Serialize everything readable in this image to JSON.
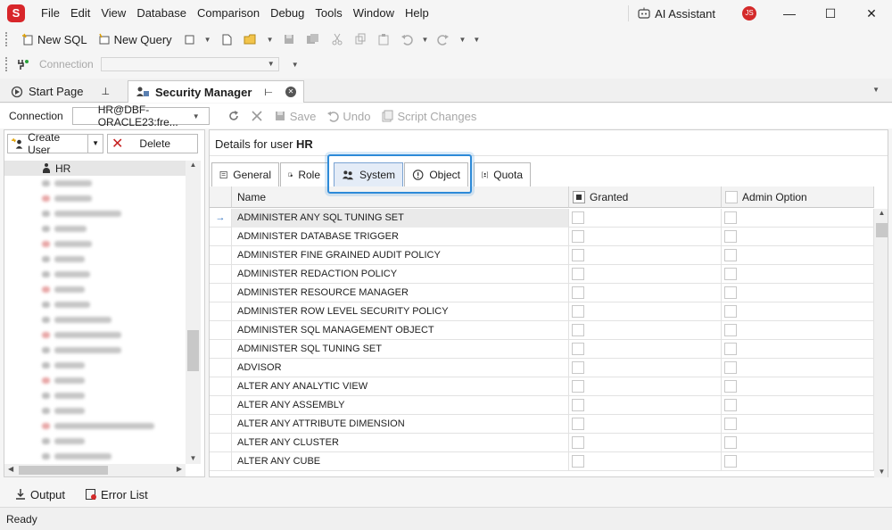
{
  "app": {
    "logo_letter": "S",
    "accent_color": "#d8262a"
  },
  "menu": [
    "File",
    "Edit",
    "View",
    "Database",
    "Comparison",
    "Debug",
    "Tools",
    "Window",
    "Help"
  ],
  "titlebar": {
    "ai_assistant": "AI Assistant",
    "user_initials": "JS"
  },
  "toolbar1": {
    "new_sql": "New SQL",
    "new_query": "New Query"
  },
  "toolbar2": {
    "connection_label": "Connection",
    "connection_value": ""
  },
  "doc_tabs": [
    {
      "label": "Start Page",
      "active": false
    },
    {
      "label": "Security Manager",
      "active": true
    }
  ],
  "sm_toolbar": {
    "connection_label": "Connection",
    "connection_value": "HR@DBF-ORACLE23:fre...",
    "save": "Save",
    "undo": "Undo",
    "script_changes": "Script Changes"
  },
  "left_panel": {
    "create_user": "Create User",
    "delete": "Delete",
    "selected_user": "HR",
    "blurred_user_count": 20
  },
  "details": {
    "title_prefix": "Details for user",
    "user": "HR",
    "tabs": [
      "General",
      "Role",
      "System",
      "Object",
      "Quota"
    ],
    "selected_tab": "System",
    "columns": {
      "name": "Name",
      "granted": "Granted",
      "admin_option": "Admin Option"
    },
    "privileges": [
      "ADMINISTER ANY SQL TUNING SET",
      "ADMINISTER DATABASE TRIGGER",
      "ADMINISTER FINE GRAINED AUDIT POLICY",
      "ADMINISTER REDACTION POLICY",
      "ADMINISTER RESOURCE MANAGER",
      "ADMINISTER ROW LEVEL SECURITY POLICY",
      "ADMINISTER SQL MANAGEMENT OBJECT",
      "ADMINISTER SQL TUNING SET",
      "ADVISOR",
      "ALTER ANY ANALYTIC VIEW",
      "ALTER ANY ASSEMBLY",
      "ALTER ANY ATTRIBUTE DIMENSION",
      "ALTER ANY CLUSTER",
      "ALTER ANY CUBE"
    ]
  },
  "bottom": {
    "output": "Output",
    "error_list": "Error List"
  },
  "status": {
    "text": "Ready"
  }
}
